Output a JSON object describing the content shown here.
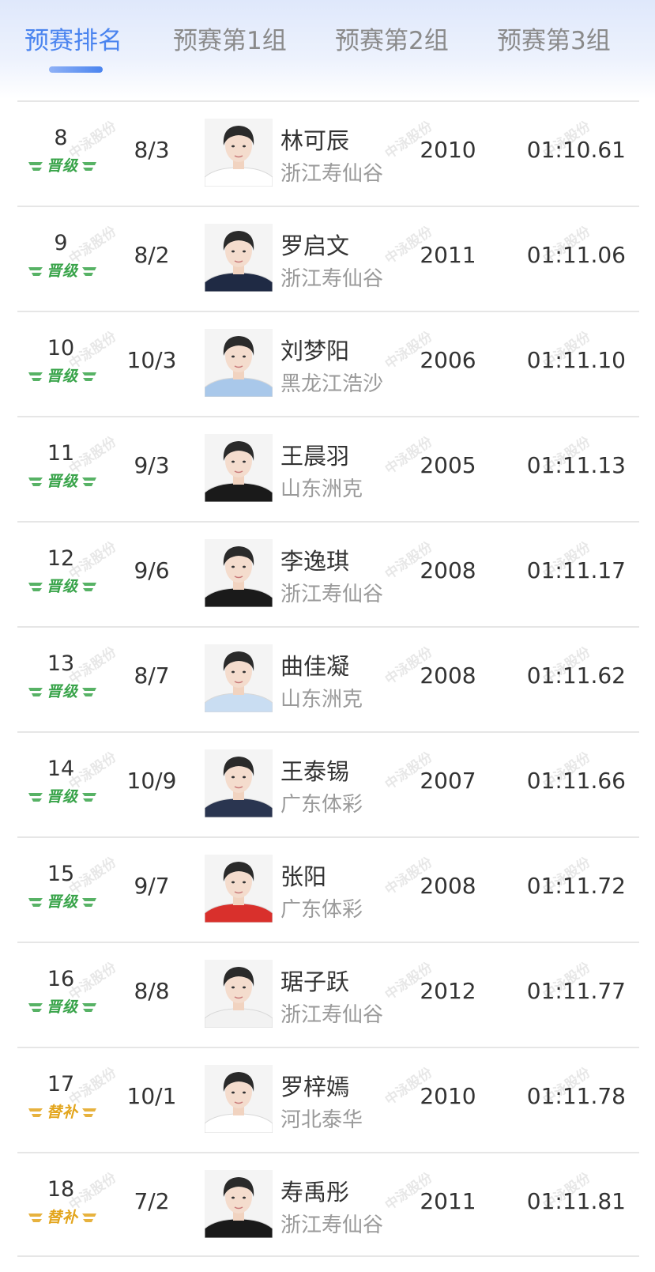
{
  "tabs": [
    {
      "label": "预赛排名",
      "active": true
    },
    {
      "label": "预赛第1组",
      "active": false
    },
    {
      "label": "预赛第2组",
      "active": false
    },
    {
      "label": "预赛第3组",
      "active": false
    }
  ],
  "colors": {
    "accent": "#4a84ef",
    "promote": "#39a44a",
    "reserve": "#e3a51c"
  },
  "watermark": "中泳股份",
  "rows": [
    {
      "rank": "8",
      "status": "晋级",
      "lane": "8/3",
      "name": "林可辰",
      "team": "浙江寿仙谷",
      "year": "2010",
      "time": "01:10.61",
      "shirt": "#ffffff"
    },
    {
      "rank": "9",
      "status": "晋级",
      "lane": "8/2",
      "name": "罗启文",
      "team": "浙江寿仙谷",
      "year": "2011",
      "time": "01:11.06",
      "shirt": "#1f2a44"
    },
    {
      "rank": "10",
      "status": "晋级",
      "lane": "10/3",
      "name": "刘梦阳",
      "team": "黑龙江浩沙",
      "year": "2006",
      "time": "01:11.10",
      "shirt": "#a9c8ea"
    },
    {
      "rank": "11",
      "status": "晋级",
      "lane": "9/3",
      "name": "王晨羽",
      "team": "山东洲克",
      "year": "2005",
      "time": "01:11.13",
      "shirt": "#1a1a1a"
    },
    {
      "rank": "12",
      "status": "晋级",
      "lane": "9/6",
      "name": "李逸琪",
      "team": "浙江寿仙谷",
      "year": "2008",
      "time": "01:11.17",
      "shirt": "#1a1a1a"
    },
    {
      "rank": "13",
      "status": "晋级",
      "lane": "8/7",
      "name": "曲佳凝",
      "team": "山东洲克",
      "year": "2008",
      "time": "01:11.62",
      "shirt": "#c9ddf2"
    },
    {
      "rank": "14",
      "status": "晋级",
      "lane": "10/9",
      "name": "王泰锡",
      "team": "广东体彩",
      "year": "2007",
      "time": "01:11.66",
      "shirt": "#2a3550"
    },
    {
      "rank": "15",
      "status": "晋级",
      "lane": "9/7",
      "name": "张阳",
      "team": "广东体彩",
      "year": "2008",
      "time": "01:11.72",
      "shirt": "#d9302c"
    },
    {
      "rank": "16",
      "status": "晋级",
      "lane": "8/8",
      "name": "琚子跃",
      "team": "浙江寿仙谷",
      "year": "2012",
      "time": "01:11.77",
      "shirt": "#f2f2f2"
    },
    {
      "rank": "17",
      "status": "替补",
      "lane": "10/1",
      "name": "罗梓嫣",
      "team": "河北泰华",
      "year": "2010",
      "time": "01:11.78",
      "shirt": "#ffffff"
    },
    {
      "rank": "18",
      "status": "替补",
      "lane": "7/2",
      "name": "寿禹彤",
      "team": "浙江寿仙谷",
      "year": "2011",
      "time": "01:11.81",
      "shirt": "#1a1a1a"
    }
  ]
}
